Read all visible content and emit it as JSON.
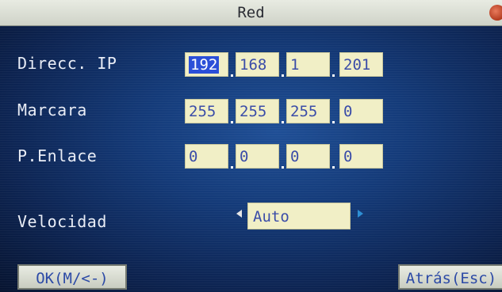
{
  "window": {
    "title": "Red"
  },
  "fields": {
    "ip": {
      "label": "Direcc. IP",
      "octets": [
        "192",
        "168",
        "1",
        "201"
      ]
    },
    "mask": {
      "label": "Marcara",
      "octets": [
        "255",
        "255",
        "255",
        "0"
      ]
    },
    "gateway": {
      "label": "P.Enlace",
      "octets": [
        "0",
        "0",
        "0",
        "0"
      ]
    },
    "speed": {
      "label": "Velocidad",
      "value": "Auto"
    }
  },
  "buttons": {
    "ok_label": "OK(M/<-)",
    "back_label": "Atrás(Esc)"
  },
  "colors": {
    "background": "#143a78",
    "field_fill": "#f1efc6",
    "field_text": "#3a4ca8",
    "selection": "#2b4fd8",
    "label_text": "#e9edf6"
  },
  "icons": {
    "close": "close-icon",
    "speed_prev": "arrow-left-icon",
    "speed_next": "arrow-right-icon"
  }
}
